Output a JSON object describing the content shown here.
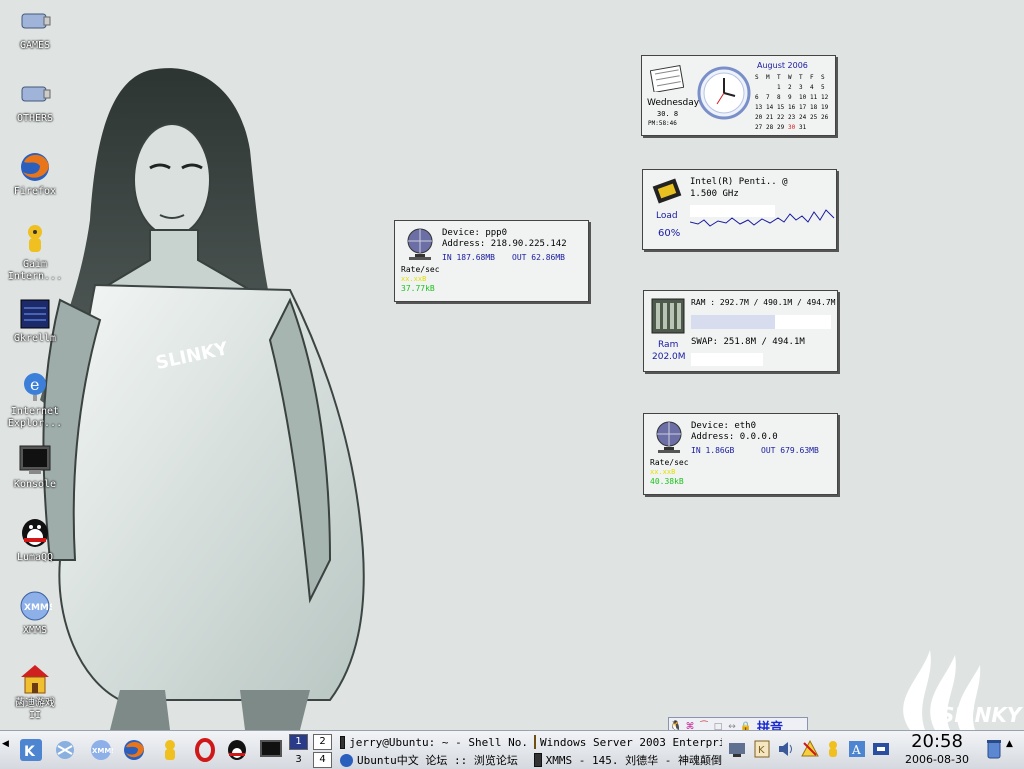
{
  "desktop": {
    "icons": [
      {
        "label": "GAMES"
      },
      {
        "label": "OTHERS"
      },
      {
        "label": "Firefox"
      },
      {
        "label": "Gaim\nIntern..."
      },
      {
        "label": "Gkrellm"
      },
      {
        "label": "Internet\nExplor..."
      },
      {
        "label": "Konsole"
      },
      {
        "label": "LumaQQ"
      },
      {
        "label": "XMMS"
      },
      {
        "label": "菡迪游戏\nII"
      }
    ],
    "wallpaper_text": "SLINKY",
    "brand_logo_text": "SLINKY"
  },
  "calendar_widget": {
    "month_title": "August 2006",
    "weekday": "Wednesday",
    "date_line": "30. 8",
    "time_line": "PM:58:46",
    "day_headers": [
      "S",
      "M",
      "T",
      "W",
      "T",
      "F",
      "S"
    ],
    "weeks": [
      [
        "",
        "",
        "1",
        "2",
        "3",
        "4",
        "5"
      ],
      [
        "6",
        "7",
        "8",
        "9",
        "10",
        "11",
        "12"
      ],
      [
        "13",
        "14",
        "15",
        "16",
        "17",
        "18",
        "19"
      ],
      [
        "20",
        "21",
        "22",
        "23",
        "24",
        "25",
        "26"
      ],
      [
        "27",
        "28",
        "29",
        "30",
        "31",
        "",
        ""
      ]
    ],
    "today": "30"
  },
  "cpu_widget": {
    "name": "Intel(R) Penti.. @",
    "freq": "1.500 GHz",
    "load_label": "Load",
    "load_value": "60%",
    "load_fraction": 0.6
  },
  "net_ppp0": {
    "device": "Device: ppp0",
    "address": "Address: 218.90.225.142",
    "in": "IN 187.68MB",
    "out": "OUT 62.86MB",
    "rate_label": "Rate/sec",
    "rate_in": "xx.xxB",
    "rate_out": "37.77kB"
  },
  "ram_widget": {
    "ram_text": "RAM : 292.7M / 490.1M / 494.7M",
    "swap_text": "SWAP: 251.8M / 494.1M",
    "label": "Ram",
    "value": "202.0M",
    "ram_fraction": 0.6,
    "swap_fraction": 0.0
  },
  "net_eth0": {
    "device": "Device: eth0",
    "address": "Address: 0.0.0.0",
    "in": "IN 1.86GB",
    "out": "OUT 679.63MB",
    "rate_label": "Rate/sec",
    "rate_in": "xx.xxB",
    "rate_out": "40.38kB"
  },
  "ime_bar": {
    "label": "拼音"
  },
  "taskbar": {
    "pager": [
      "1",
      "2",
      "3",
      "4"
    ],
    "tasks": [
      {
        "label": "jerry@Ubuntu: ~ - Shell No."
      },
      {
        "label": "Windows Server 2003 Enterpri"
      },
      {
        "label": "Ubuntu中文 论坛 :: 浏览论坛"
      },
      {
        "label": "XMMS - 145. 刘德华 - 神魂颠倒"
      }
    ],
    "clock_time": "20:58",
    "clock_date": "2006-08-30"
  },
  "colors": {
    "desktop_bg": "#dfe4e2",
    "accent_blue": "#1a1aa0",
    "rate_green": "#20c020",
    "rate_yellow": "#e0e000"
  }
}
